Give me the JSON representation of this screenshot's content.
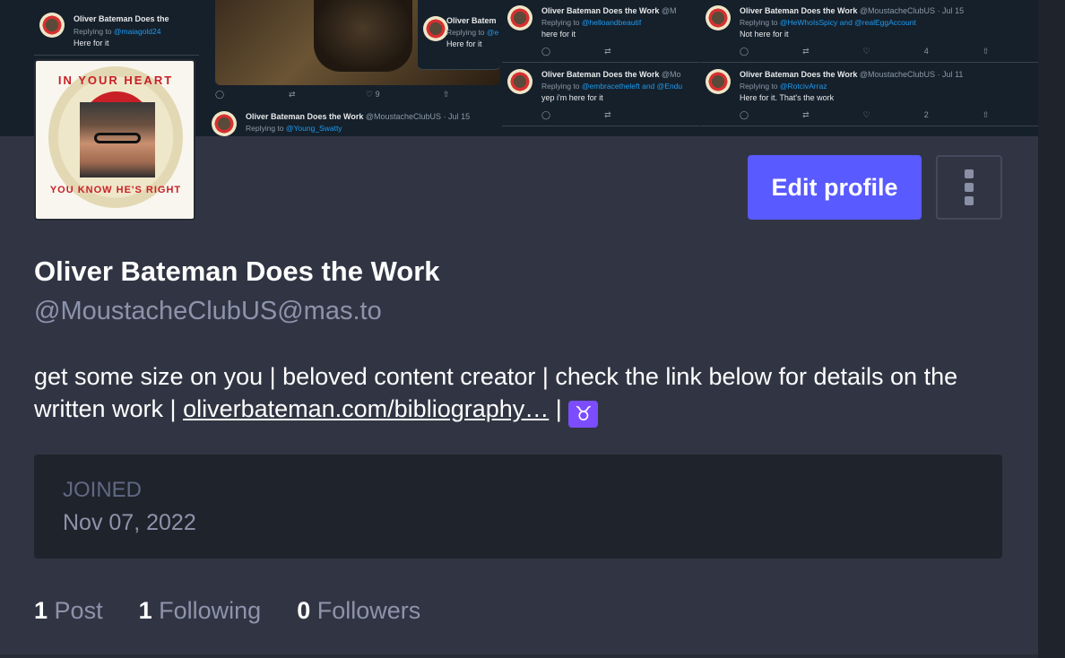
{
  "header": {
    "tweets": [
      {
        "name": "Oliver Bateman Does the",
        "handle": "",
        "reply_to": "@maiagold24",
        "text": "Here for it"
      },
      {
        "name": "Oliver Batem",
        "handle": "",
        "reply_to": "@e",
        "text": "Here for it"
      },
      {
        "name": "Oliver Bateman Does the Work",
        "handle": "@MoustacheClubUS · Jul 15",
        "reply_to": "@Young_Swatty",
        "text": ""
      },
      {
        "name": "Oliver Bateman Does the Work",
        "handle": "@M",
        "reply_to": "@helloandbeautif",
        "text": "here for it"
      },
      {
        "name": "Oliver Bateman Does the Work",
        "handle": "@MoustacheClubUS · Jul 15",
        "reply_to": "@HeWhoIsSpicy and @realEggAccount",
        "text": "Not here for it"
      },
      {
        "name": "Oliver Bateman Does the Work",
        "handle": "@Mo",
        "reply_to": "@embracetheleft and @Endu",
        "text": "yep i'm here for it"
      },
      {
        "name": "Oliver Bateman Does the Work",
        "handle": "@MoustacheClubUS · Jul 11",
        "reply_to": "@RotcivArraz",
        "text": "Here for it. That's the work"
      }
    ],
    "photo_likes": "9",
    "counts": [
      "4",
      "2"
    ]
  },
  "avatar": {
    "badge_top": "IN YOUR HEART",
    "badge_bottom": "YOU KNOW HE'S RIGHT"
  },
  "actions": {
    "edit_label": "Edit profile"
  },
  "profile": {
    "display_name": "Oliver Bateman Does the Work",
    "handle": "@MoustacheClubUS@mas.to",
    "bio_text": "get some size on you | beloved content creator | check the link below for details on the written work | ",
    "bio_link": "oliverbateman.com/bibliography…",
    "bio_sep": " | ",
    "bio_emoji": "♉"
  },
  "joined": {
    "label": "JOINED",
    "date": "Nov 07, 2022"
  },
  "stats": {
    "posts_count": "1",
    "posts_label": "Post",
    "following_count": "1",
    "following_label": "Following",
    "followers_count": "0",
    "followers_label": "Followers"
  },
  "colors": {
    "accent": "#595aff",
    "background": "#313543",
    "card": "#1f232b"
  }
}
